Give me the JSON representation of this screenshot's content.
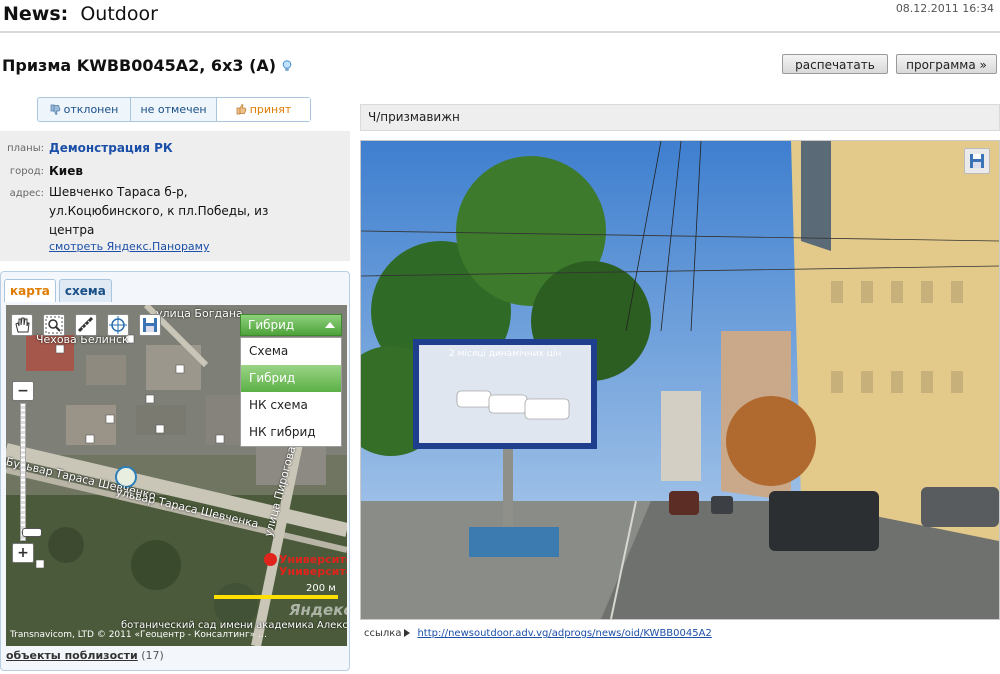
{
  "header": {
    "brand_bold": "News:",
    "brand_section": "Outdoor",
    "datetime": "08.12.2011 16:34"
  },
  "object": {
    "title": "Призма KWBB0045A2,  6x3 (A)",
    "print_label": "распечатать",
    "program_label": "программа »"
  },
  "status": {
    "rejected": "отклонен",
    "not_marked": "не отмечен",
    "accepted": "принят"
  },
  "info": {
    "plans_label": "планы:",
    "plans_value": "Демонстрация РК",
    "city_label": "город:",
    "city_value": "Киев",
    "address_label": "адрес:",
    "address_value": "Шевченко Тараса б-р, ул.Коцюбинского, к пл.Победы, из центра",
    "panorama_link": "смотреть Яндекс.Панораму"
  },
  "map": {
    "tabs": [
      "карта",
      "схема"
    ],
    "layer_selected": "Гибрид",
    "layer_options": [
      "Схема",
      "Гибрид",
      "НК схема",
      "НК гибрид"
    ],
    "scale_label": "200 м",
    "metro_label_1": "Университет",
    "metro_label_2": "Университет",
    "copyright": "Transnavicom, LTD  © 2011 «Геоцентр - Консалтинг» …",
    "watermark": "Яндекс",
    "streets": {
      "bogdana": "улица Богдана",
      "belinsk": "Чехова Белинск",
      "shevchenko": "Бульвар Тараса Шевченко",
      "shevchenko2": "ульвар Тараса Шевченка",
      "pirogova": "улица Пирогова",
      "garden": "ботанический сад имени академика Александра Фомина"
    },
    "nearby_label": "объекты поблизости",
    "nearby_count": "(17)"
  },
  "photo": {
    "caption": "Ч/призмавижн",
    "billboard_text": "2 місяці динамічних цін",
    "link_label": "ссылка",
    "link_url": "http://newsoutdoor.adv.vg/adprogs/news/oid/KWBB0045A2"
  }
}
